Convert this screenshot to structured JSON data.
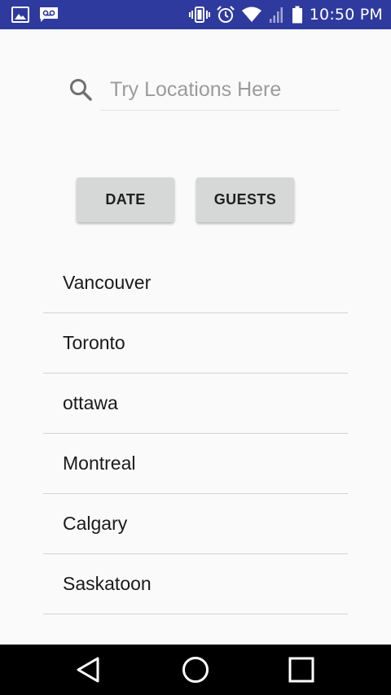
{
  "status_bar": {
    "time": "10:50 PM",
    "colors": {
      "background": "#2f3a9e",
      "foreground": "#ffffff"
    },
    "left_icons": [
      "image-notification-icon",
      "voicemail-icon"
    ],
    "right_icons": [
      "vibrate-icon",
      "alarm-icon",
      "wifi-icon",
      "signal-icon",
      "battery-icon"
    ]
  },
  "search": {
    "placeholder": "Try Locations Here",
    "value": "",
    "icon": "search-icon"
  },
  "buttons": {
    "date_label": "DATE",
    "guests_label": "GUESTS"
  },
  "locations": [
    {
      "label": "Vancouver"
    },
    {
      "label": "Toronto"
    },
    {
      "label": "ottawa"
    },
    {
      "label": "Montreal"
    },
    {
      "label": "Calgary"
    },
    {
      "label": "Saskatoon"
    }
  ],
  "nav_bar": {
    "icons": [
      "back-icon",
      "home-icon",
      "recents-icon"
    ]
  },
  "colors": {
    "page_background": "#fafafa",
    "button_background": "#d6d7d7",
    "divider": "#d2d2d2",
    "placeholder_text": "#9b9b9b"
  }
}
